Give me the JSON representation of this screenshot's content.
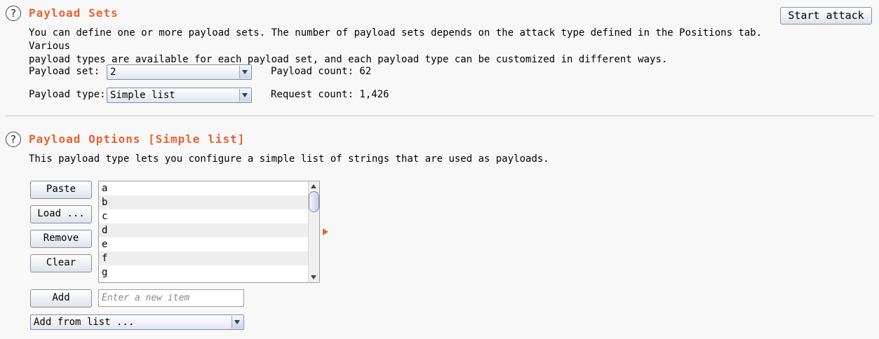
{
  "payload_sets": {
    "title": "Payload Sets",
    "description_line1": "You can define one or more payload sets. The number of payload sets depends on the attack type defined in the Positions tab. Various",
    "description_line2": "payload types are available for each payload set, and each payload type can be customized in different ways.",
    "payload_set_label": "Payload set:",
    "payload_set_value": "2",
    "payload_type_label": "Payload type:",
    "payload_type_value": "Simple list",
    "payload_count": "Payload count: 62",
    "request_count": "Request count: 1,426"
  },
  "toolbar": {
    "start_attack_label": "Start attack"
  },
  "payload_options": {
    "title": "Payload Options [Simple list]",
    "description": "This payload type lets you configure a simple list of strings that are used as payloads.",
    "buttons": {
      "paste": "Paste",
      "load": "Load ...",
      "remove": "Remove",
      "clear": "Clear",
      "add": "Add"
    },
    "list_items": [
      "a",
      "b",
      "c",
      "d",
      "e",
      "f",
      "g"
    ],
    "new_item_placeholder": "Enter a new item",
    "add_from_list_value": "Add from list ..."
  },
  "colors": {
    "accent": "#e8622e",
    "background": "#f8f8f8"
  },
  "icons": [
    "help-icon",
    "chevron-down-icon",
    "expand-arrow-icon",
    "scroll-up-icon",
    "scroll-down-icon"
  ]
}
